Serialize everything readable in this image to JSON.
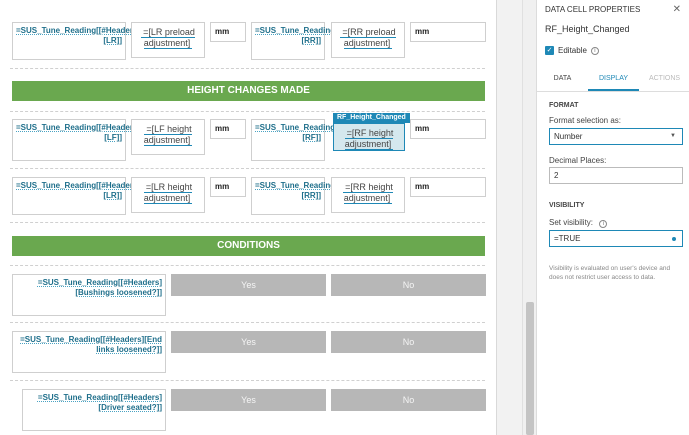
{
  "rows": {
    "preload": {
      "left_ref": "=SUS_Tune_Reading[[#Headers][LR]]",
      "left_input": "=[LR preload adjustment]",
      "unit1": "mm",
      "right_ref": "=SUS_Tune_Reading[[#Headers][RR]]",
      "right_input": "=[RR preload adjustment]",
      "unit2": "mm"
    },
    "height_front": {
      "left_ref": "=SUS_Tune_Reading[[#Headers][LF]]",
      "left_input": "=[LF height adjustment]",
      "unit1": "mm",
      "right_ref": "=SUS_Tune_Reading[[#Headers][RF]]",
      "right_input": "=[RF height adjustment]",
      "unit2": "mm",
      "selected_tag": "RF_Height_Changed"
    },
    "height_rear": {
      "left_ref": "=SUS_Tune_Reading[[#Headers][LR]]",
      "left_input": "=[LR height adjustment]",
      "unit1": "mm",
      "right_ref": "=SUS_Tune_Reading[[#Headers][RR]]",
      "right_input": "=[RR height adjustment]",
      "unit2": "mm"
    },
    "bushings": {
      "ref": "=SUS_Tune_Reading[[#Headers][Bushings loosened?]]",
      "yes": "Yes",
      "no": "No"
    },
    "endlinks": {
      "ref": "=SUS_Tune_Reading[[#Headers][End links loosened?]]",
      "yes": "Yes",
      "no": "No"
    },
    "driver": {
      "ref": "=SUS_Tune_Reading[[#Headers][Driver seated?]]",
      "yes": "Yes",
      "no": "No"
    }
  },
  "banners": {
    "height": "HEIGHT CHANGES MADE",
    "conditions": "CONDITIONS"
  },
  "panel": {
    "title": "DATA CELL PROPERTIES",
    "cell_name": "RF_Height_Changed",
    "editable_label": "Editable",
    "tabs": [
      "DATA",
      "DISPLAY",
      "ACTIONS"
    ],
    "format_title": "FORMAT",
    "format_selection_label": "Format selection as:",
    "format_value": "Number",
    "decimal_label": "Decimal Places:",
    "decimal_value": "2",
    "visibility_title": "VISIBILITY",
    "set_visibility_label": "Set visibility:",
    "visibility_value": "=TRUE",
    "visibility_note": "Visibility is evaluated on user's device and does not restrict user access to data."
  },
  "colors": {
    "accent": "#1e88b6",
    "banner": "#6aa84f",
    "button": "#b7b7b7"
  }
}
